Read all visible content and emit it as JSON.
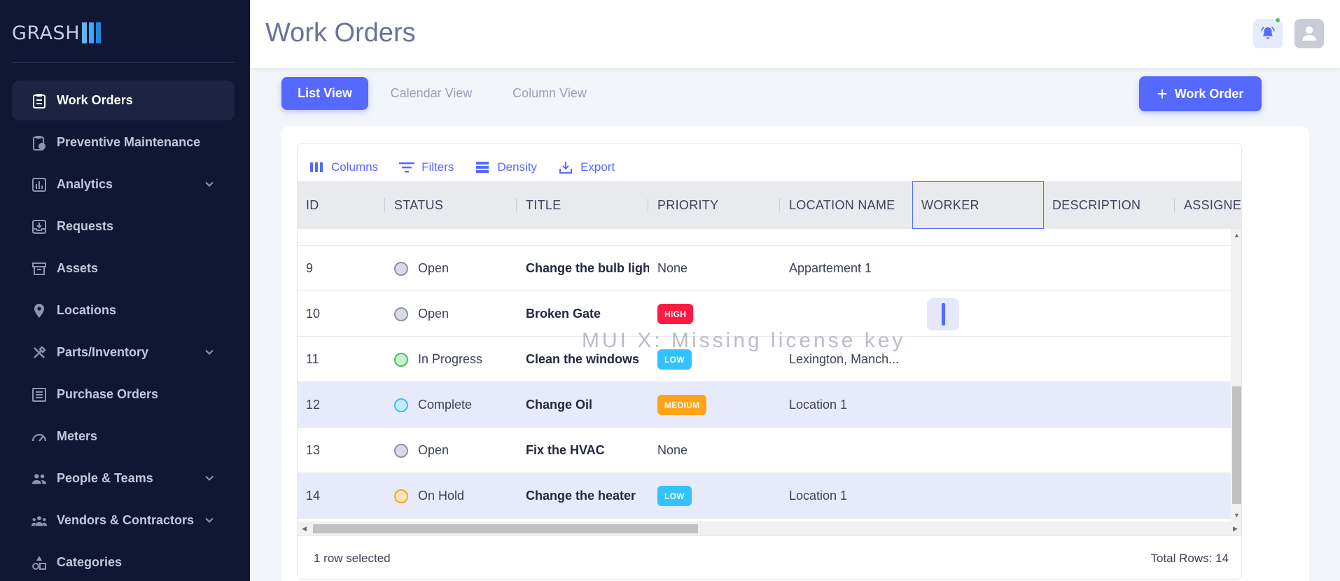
{
  "brand": {
    "name": "GRASH"
  },
  "sidebar": {
    "items": [
      {
        "label": "Work Orders",
        "icon": "clipboard-icon",
        "active": true,
        "expandable": false
      },
      {
        "label": "Preventive Maintenance",
        "icon": "clipboard-clock-icon",
        "active": false,
        "expandable": false
      },
      {
        "label": "Analytics",
        "icon": "bar-chart-icon",
        "active": false,
        "expandable": true
      },
      {
        "label": "Requests",
        "icon": "inbox-download-icon",
        "active": false,
        "expandable": false
      },
      {
        "label": "Assets",
        "icon": "archive-box-icon",
        "active": false,
        "expandable": false
      },
      {
        "label": "Locations",
        "icon": "map-pin-icon",
        "active": false,
        "expandable": false
      },
      {
        "label": "Parts/Inventory",
        "icon": "tools-icon",
        "active": false,
        "expandable": true
      },
      {
        "label": "Purchase Orders",
        "icon": "list-document-icon",
        "active": false,
        "expandable": false
      },
      {
        "label": "Meters",
        "icon": "gauge-icon",
        "active": false,
        "expandable": false
      },
      {
        "label": "People & Teams",
        "icon": "people-icon",
        "active": false,
        "expandable": true
      },
      {
        "label": "Vendors & Contractors",
        "icon": "group-icon",
        "active": false,
        "expandable": true
      },
      {
        "label": "Categories",
        "icon": "shapes-icon",
        "active": false,
        "expandable": false
      }
    ]
  },
  "header": {
    "title": "Work Orders"
  },
  "views": {
    "list": "List View",
    "calendar": "Calendar View",
    "column": "Column View"
  },
  "add_button": {
    "label": "Work Order"
  },
  "toolbar": {
    "columns": "Columns",
    "filters": "Filters",
    "density": "Density",
    "export": "Export"
  },
  "table": {
    "columns": [
      "ID",
      "STATUS",
      "TITLE",
      "PRIORITY",
      "LOCATION NAME",
      "WORKER",
      "DESCRIPTION",
      "ASSIGNED"
    ],
    "rows": [
      {
        "id": "9",
        "status": "Open",
        "title": "Change the bulb light",
        "priority": "None",
        "location": "Appartement 1",
        "selected": false
      },
      {
        "id": "10",
        "status": "Open",
        "title": "Broken Gate",
        "priority": "HIGH",
        "location": "",
        "selected": false
      },
      {
        "id": "11",
        "status": "In Progress",
        "title": "Clean the windows",
        "priority": "LOW",
        "location": "Lexington, Manch...",
        "selected": false
      },
      {
        "id": "12",
        "status": "Complete",
        "title": "Change Oil",
        "priority": "MEDIUM",
        "location": "Location 1",
        "selected": true
      },
      {
        "id": "13",
        "status": "Open",
        "title": "Fix the HVAC",
        "priority": "None",
        "location": "",
        "selected": false
      },
      {
        "id": "14",
        "status": "On Hold",
        "title": "Change the heater",
        "priority": "LOW",
        "location": "Location 1",
        "selected": true
      }
    ]
  },
  "status_colors": {
    "Open": {
      "border": "#8e93a8",
      "fill": "#d9dbe6"
    },
    "In Progress": {
      "border": "#44c35c",
      "fill": "#c8f0cf"
    },
    "Complete": {
      "border": "#33c2ff",
      "fill": "#c5ecfd"
    },
    "On Hold": {
      "border": "#ffa319",
      "fill": "#ffe5c0"
    }
  },
  "priority_colors": {
    "HIGH": "#ff1943",
    "MEDIUM": "#ffa319",
    "LOW": "#33c2ff"
  },
  "footer": {
    "selected_text": "1 row selected",
    "total_text": "Total Rows: 14"
  },
  "watermark": "MUI X: Missing license key"
}
